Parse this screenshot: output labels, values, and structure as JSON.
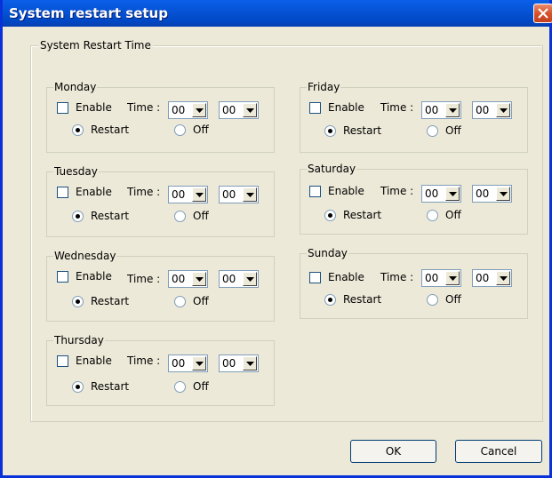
{
  "window": {
    "title": "System restart setup"
  },
  "group": {
    "label": "System Restart Time"
  },
  "labels": {
    "enable": "Enable",
    "time": "Time :",
    "restart": "Restart",
    "off": "Off"
  },
  "days": [
    {
      "name": "Monday",
      "hour": "00",
      "minute": "00",
      "enabled": false,
      "mode": "Restart"
    },
    {
      "name": "Tuesday",
      "hour": "00",
      "minute": "00",
      "enabled": false,
      "mode": "Restart"
    },
    {
      "name": "Wednesday",
      "hour": "00",
      "minute": "00",
      "enabled": false,
      "mode": "Restart"
    },
    {
      "name": "Thursday",
      "hour": "00",
      "minute": "00",
      "enabled": false,
      "mode": "Restart"
    },
    {
      "name": "Friday",
      "hour": "00",
      "minute": "00",
      "enabled": false,
      "mode": "Restart"
    },
    {
      "name": "Saturday",
      "hour": "00",
      "minute": "00",
      "enabled": false,
      "mode": "Restart"
    },
    {
      "name": "Sunday",
      "hour": "00",
      "minute": "00",
      "enabled": false,
      "mode": "Restart"
    }
  ],
  "buttons": {
    "ok": "OK",
    "cancel": "Cancel"
  }
}
